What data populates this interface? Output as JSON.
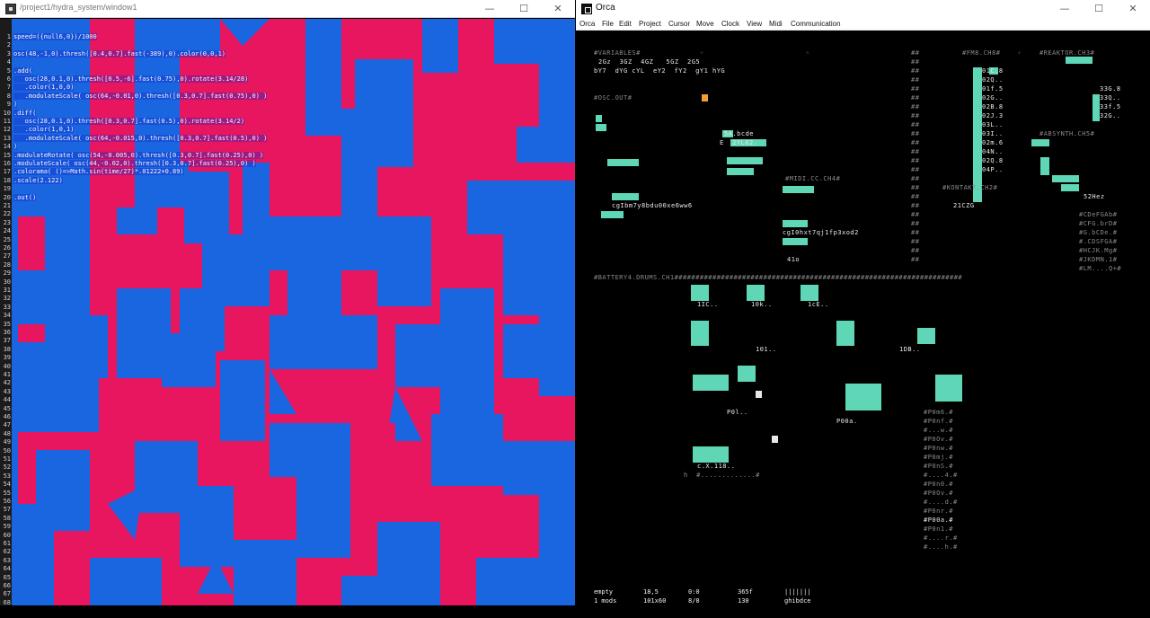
{
  "left_window": {
    "title": "/project1/hydra_system/window1",
    "controls": {
      "minimize": "—",
      "maximize": "☐",
      "close": "✕"
    },
    "code_lines": [
      {
        "n": "1",
        "text": "speed=({null6,0})/1000"
      },
      {
        "n": "2",
        "text": ""
      },
      {
        "n": "3",
        "text": "osc(48,-1,0).thresh([0.4,0.7].fast(-389),0).color(0,0,1)"
      },
      {
        "n": "4",
        "text": ""
      },
      {
        "n": "5",
        "text": ".add("
      },
      {
        "n": "6",
        "text": "   osc(28,0.1,0).thresh([0.5,-6].fast(0.75),0).rotate(3.14/28)"
      },
      {
        "n": "7",
        "text": "   .color(1,0,0)"
      },
      {
        "n": "8",
        "text": "   .modulateScale( osc(64,-0.01,0).thresh([0.3,0.7].fast(0.75),0) )"
      },
      {
        "n": "9",
        "text": ")"
      },
      {
        "n": "10",
        "text": ".diff("
      },
      {
        "n": "11",
        "text": "   osc(28,0.1,0).thresh([0.3,0.7].fast(0.5),0).rotate(3.14/2)"
      },
      {
        "n": "12",
        "text": "   .color(1,0,1)"
      },
      {
        "n": "13",
        "text": "   .modulateScale( osc(64,-0.015,0).thresh([0.3,0.7].fast(0.5),0) )"
      },
      {
        "n": "14",
        "text": ")"
      },
      {
        "n": "15",
        "text": ".modulateRotate( osc(54,-0.005,0).thresh([0.3,0.7].fast(0.25),0) )"
      },
      {
        "n": "16",
        "text": ".modulateScale( osc(44,-0.02,0).thresh([0.3,0.7].fast(0.25),0) )"
      },
      {
        "n": "17",
        "text": ".colorama( ()=>Math.sin(time/27)*.01222+0.89)"
      },
      {
        "n": "18",
        "text": ".scale(2.122)"
      },
      {
        "n": "19",
        "text": ""
      },
      {
        "n": "20",
        "text": ".out()"
      }
    ],
    "line_count": 68,
    "colors": {
      "magenta": "#e8155f",
      "blue": "#1a66e0"
    }
  },
  "right_window": {
    "title": "Orca",
    "controls": {
      "minimize": "—",
      "maximize": "☐",
      "close": "✕"
    },
    "menu": [
      "Orca",
      "File",
      "Edit",
      "Project",
      "Cursor",
      "Move",
      "Clock",
      "View",
      "Midi",
      "Communication"
    ],
    "labels": {
      "variables": "#VARIABLES#",
      "osc_out": "#OSC.OUT#",
      "midi_cc": "#MIDI.CC.CH4#",
      "fm8": "#FM8.CH8#",
      "reaktor": "#REAKTOR.CH3#",
      "absynth": "#ABSYNTH.CH5#",
      "kontakt": "#KONTAKT.CH2#",
      "battery": "#BATTERY4.DRUMS.CH1####################################################################",
      "notes_right": [
        "#CDeFGAb#",
        "#CFG.brD#",
        "#G.bCDe.#",
        "#.CDSFGA#",
        "#HCJK.Mg#",
        "#JKDMN.1#",
        "#LM....Q+#"
      ],
      "p_column": [
        "#P0m6.#",
        "#P0nf.#",
        "#...w.#",
        "#P0Ov.#",
        "#P0nw.#",
        "#P0mj.#",
        "#P0nS.#",
        "#....4.#",
        "#P0n0.#",
        "#P0Ov.#",
        "#....d.#",
        "#P0nr.#",
        "#P00a.#",
        "#P0n1.#",
        "#....r.#",
        "#....h.#"
      ],
      "fragments": {
        "v1": "2Gz  3GZ  4GZ   5GZ  2G5",
        "v2": "bY7  dYG cYL  eY2  fY2  gY1 hYG",
        "bcde": "5A.bcde",
        "yl02": "E  2YL02.",
        "seq1": "cgIbm7y8bdu00xe6ww6",
        "seq2": "cgI0hxt7qj1fp3xod2",
        "fm_vals": [
          "01C.8",
          "02Q..",
          "01f.5",
          "02G..",
          "02B.8",
          "02J.3",
          "03L..",
          "03I..",
          "02m.6",
          "04N..",
          "02Q.8",
          "04P.."
        ],
        "reaktor_vals": [
          "33G.8",
          "33Q..",
          "33f.5",
          "32G.."
        ],
        "kontakt_val": "21CZG",
        "absynth_val": "52Hez",
        "b1": "1IC..",
        "b2": "10k..",
        "b3": "1cE..",
        "b4": "101..",
        "b5": "1DB..",
        "b6": "P0l..",
        "b7": "P00a.",
        "b8": "c.X.118..",
        "b9": "h  #.............#",
        "e41": "41o"
      }
    },
    "status_bar": {
      "row1": [
        "empty",
        "18,5",
        "0:0",
        "365f",
        "|||||||"
      ],
      "row2": [
        "1 mods",
        "101x60",
        "8/8",
        "130",
        "ghibdce"
      ]
    },
    "colors": {
      "accent": "#5fd6b6",
      "highlight": "#f0a030",
      "text": "#e8e8e8"
    }
  }
}
